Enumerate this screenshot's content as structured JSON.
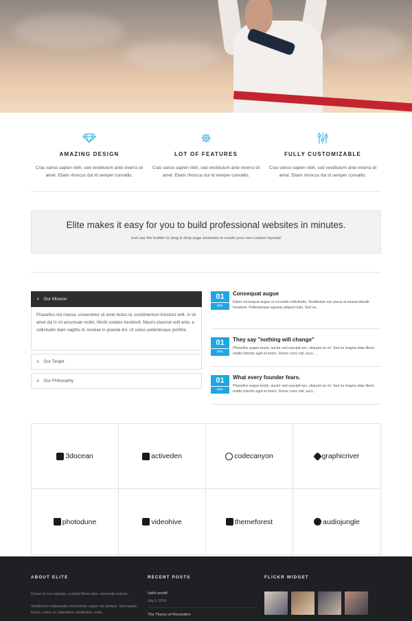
{
  "hero": {
    "image_alt": "man crossing finish line"
  },
  "features": [
    {
      "icon": "diamond-icon",
      "title": "AMAZING DESIGN",
      "text": "Cras varius sapien nibh, sed vestibulum ante viverra sit amet. Etiam rhoncus dui id semper convallis."
    },
    {
      "icon": "gear-icon",
      "title": "LOT OF FEATURES",
      "text": "Cras varius sapien nibh, sed vestibulum ante viverra sit amet. Etiam rhoncus dui id semper convallis."
    },
    {
      "icon": "sliders-icon",
      "title": "FULLY CUSTOMIZABLE",
      "text": "Cras varius sapien nibh, sed vestibulum ante viverra sit amet. Etiam rhoncus dui id semper convallis."
    }
  ],
  "cta": {
    "title": "Elite makes it easy for you to build professional websites in minutes.",
    "subtitle": "Just use the builder to drag & drop page elements to create your own custom layouts!"
  },
  "accordion": [
    {
      "label": "Our Mission",
      "body": "Phasellus nisi massa, consectetur sit amet lectus id, condimentum tincidunt velit. In sit amet dui in mi accumsan mollis. Morbi sodales hendrerit. Mauris placerat velit ante, a sollicitudin diam sagittis id. Aenean in gravida dui. Ut varius pellentesque porttitor."
    },
    {
      "label": "Our Target"
    },
    {
      "label": "Our Philosophy"
    }
  ],
  "posts": [
    {
      "day": "01",
      "month": "JUL",
      "title": "Consequat augue",
      "excerpt": "Etiam consequat augue ut convallis sollicitudin. Vestibulum nec purus at massa blandit hendrerit. Pellentesque egestas aliquet nulla. Sed ve..."
    },
    {
      "day": "01",
      "month": "JUL",
      "title": "They say \"nothing will change\"",
      "excerpt": "Phasellus augue turpis, auctor sed suscipit nec, aliquam ac mi. Sed eu magna vitae libero mattis lobortis eget et lorem. Donec nunc nisl, auct..."
    },
    {
      "day": "01",
      "month": "JUL",
      "title": "What every founder fears.",
      "excerpt": "Phasellus augue turpis, auctor sed suscipit nec, aliquam ac mi. Sed eu magna vitae libero mattis lobortis eget et lorem. Donec nunc nisl, auct..."
    }
  ],
  "logos": [
    "3docean",
    "activeden",
    "codecanyon",
    "graphicriver",
    "photodune",
    "videohive",
    "themeforest",
    "audiojungle"
  ],
  "footer": {
    "about_title": "ABOUT ELITE",
    "about_p1": "Donec at orci egestas, suscipit libero quis, venenatis mauris.",
    "about_p2": "Vestibulum malesuada consectetur augue vel semper. Sed sapien lectus, varius ac bibendum vestibulum, nulla",
    "recent_title": "RECENT POSTS",
    "recent": [
      {
        "title": "Hello world!",
        "date": "July 5, 2014"
      },
      {
        "title": "The Theory of Revolution",
        "date": ""
      }
    ],
    "flickr_title": "FLICKR WIDGET"
  },
  "colors": {
    "accent": "#1fa5e2",
    "footer_bg": "#1f2024",
    "dark_tab": "#2e2e30"
  }
}
